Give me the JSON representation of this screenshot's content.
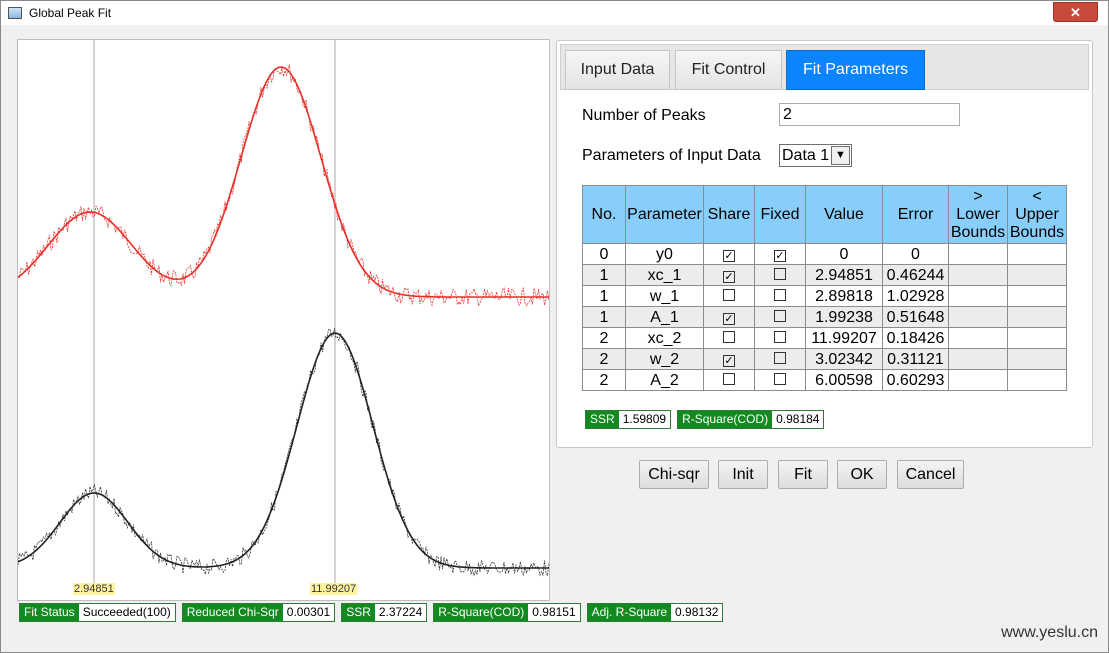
{
  "window": {
    "title": "Global Peak Fit",
    "close_label": "✕"
  },
  "plot": {
    "peak_labels": [
      "2.94851",
      "11.99207"
    ]
  },
  "status": [
    {
      "key": "Fit Status",
      "value": "Succeeded(100)"
    },
    {
      "key": "Reduced Chi-Sqr",
      "value": "0.00301"
    },
    {
      "key": "SSR",
      "value": "2.37224"
    },
    {
      "key": "R-Square(COD)",
      "value": "0.98151"
    },
    {
      "key": "Adj. R-Square",
      "value": "0.98132"
    }
  ],
  "tabs": [
    "Input Data",
    "Fit Control",
    "Fit Parameters"
  ],
  "active_tab": "Fit Parameters",
  "form": {
    "num_peaks_label": "Number of Peaks",
    "num_peaks_value": "2",
    "params_label": "Parameters of Input Data",
    "params_select": "Data 1"
  },
  "table": {
    "headers": [
      "No.",
      "Parameter",
      "Share",
      "Fixed",
      "Value",
      "Error",
      "> Lower Bounds",
      "< Upper Bounds"
    ],
    "rows": [
      {
        "no": "0",
        "param": "y0",
        "share": true,
        "fixed": true,
        "value": "0",
        "error": "0"
      },
      {
        "no": "1",
        "param": "xc_1",
        "share": true,
        "fixed": false,
        "value": "2.94851",
        "error": "0.46244"
      },
      {
        "no": "1",
        "param": "w_1",
        "share": false,
        "fixed": false,
        "value": "2.89818",
        "error": "1.02928"
      },
      {
        "no": "1",
        "param": "A_1",
        "share": true,
        "fixed": false,
        "value": "1.99238",
        "error": "0.51648"
      },
      {
        "no": "2",
        "param": "xc_2",
        "share": false,
        "fixed": false,
        "value": "11.99207",
        "error": "0.18426"
      },
      {
        "no": "2",
        "param": "w_2",
        "share": true,
        "fixed": false,
        "value": "3.02342",
        "error": "0.31121"
      },
      {
        "no": "2",
        "param": "A_2",
        "share": false,
        "fixed": false,
        "value": "6.00598",
        "error": "0.60293"
      }
    ]
  },
  "fit_stats": [
    {
      "key": "SSR",
      "value": "1.59809"
    },
    {
      "key": "R-Square(COD)",
      "value": "0.98184"
    }
  ],
  "buttons": [
    "Chi-sqr",
    "Init",
    "Fit",
    "OK",
    "Cancel"
  ],
  "watermark": "www.yeslu.cn",
  "colors": {
    "accent": "#0a84ff",
    "header": "#87cefa",
    "badge": "#138a20",
    "red_curve": "#e8302a",
    "black_curve": "#222222"
  }
}
